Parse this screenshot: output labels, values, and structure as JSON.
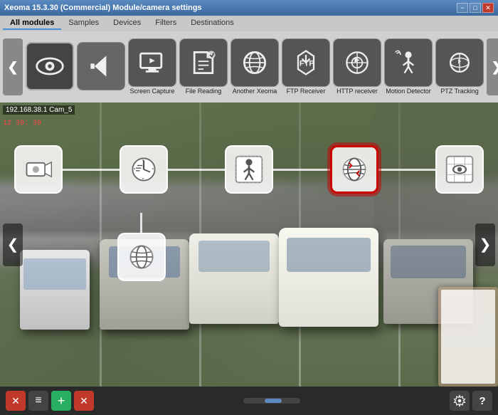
{
  "titleBar": {
    "title": "Xeoma 15.3.30 (Commercial) Module/camera settings",
    "minLabel": "−",
    "maxLabel": "□",
    "closeLabel": "✕"
  },
  "navTabs": {
    "tabs": [
      {
        "id": "all-modules",
        "label": "All modules",
        "active": true
      },
      {
        "id": "samples",
        "label": "Samples",
        "active": false
      },
      {
        "id": "devices",
        "label": "Devices",
        "active": false
      },
      {
        "id": "filters",
        "label": "Filters",
        "active": false
      },
      {
        "id": "destinations",
        "label": "Destinations",
        "active": false
      }
    ]
  },
  "moduleIcons": [
    {
      "id": "camera-icon-active",
      "label": "",
      "icon": "eye"
    },
    {
      "id": "back-arrow-module",
      "label": "",
      "icon": "back"
    },
    {
      "id": "screen-capture",
      "label": "Screen Capture",
      "icon": "screen"
    },
    {
      "id": "file-reading",
      "label": "File Reading",
      "icon": "file"
    },
    {
      "id": "another-xeoma",
      "label": "Another Xeoma",
      "icon": "globe"
    },
    {
      "id": "ftp-receiver",
      "label": "FTP Receiver",
      "icon": "ftp"
    },
    {
      "id": "http-receiver",
      "label": "HTTP receiver",
      "icon": "http"
    },
    {
      "id": "motion-detector",
      "label": "Motion Detector",
      "icon": "motion"
    },
    {
      "id": "ptz-tracking",
      "label": "PTZ Tracking",
      "icon": "ptz"
    }
  ],
  "pipeline": {
    "nodes": [
      {
        "id": "cam-node",
        "icon": "camera-pipe",
        "selected": false
      },
      {
        "id": "scheduler-node",
        "icon": "scheduler",
        "selected": false
      },
      {
        "id": "motion-node",
        "icon": "motion-pipe",
        "selected": false
      },
      {
        "id": "ftp-node",
        "icon": "ftp-pipe",
        "selected": true
      },
      {
        "id": "preview-node",
        "icon": "preview",
        "selected": false
      }
    ],
    "subNode": {
      "id": "globe-sub",
      "icon": "globe-pipe"
    }
  },
  "cameraLabel": "192.168.38.1 Cam_5",
  "timestamp": "12 39: 39",
  "bottomBar": {
    "buttons": [
      {
        "id": "delete-btn",
        "label": "✕",
        "color": "red"
      },
      {
        "id": "list-btn",
        "label": "≡",
        "color": "dark"
      },
      {
        "id": "add-btn",
        "label": "+",
        "color": "green"
      },
      {
        "id": "remove-btn",
        "label": "✕",
        "color": "red-x"
      }
    ],
    "rightButtons": [
      {
        "id": "settings-btn",
        "label": "⚙"
      },
      {
        "id": "help-btn",
        "label": "?"
      }
    ]
  },
  "feedNav": {
    "prevLabel": "❮",
    "nextLabel": "❯"
  }
}
